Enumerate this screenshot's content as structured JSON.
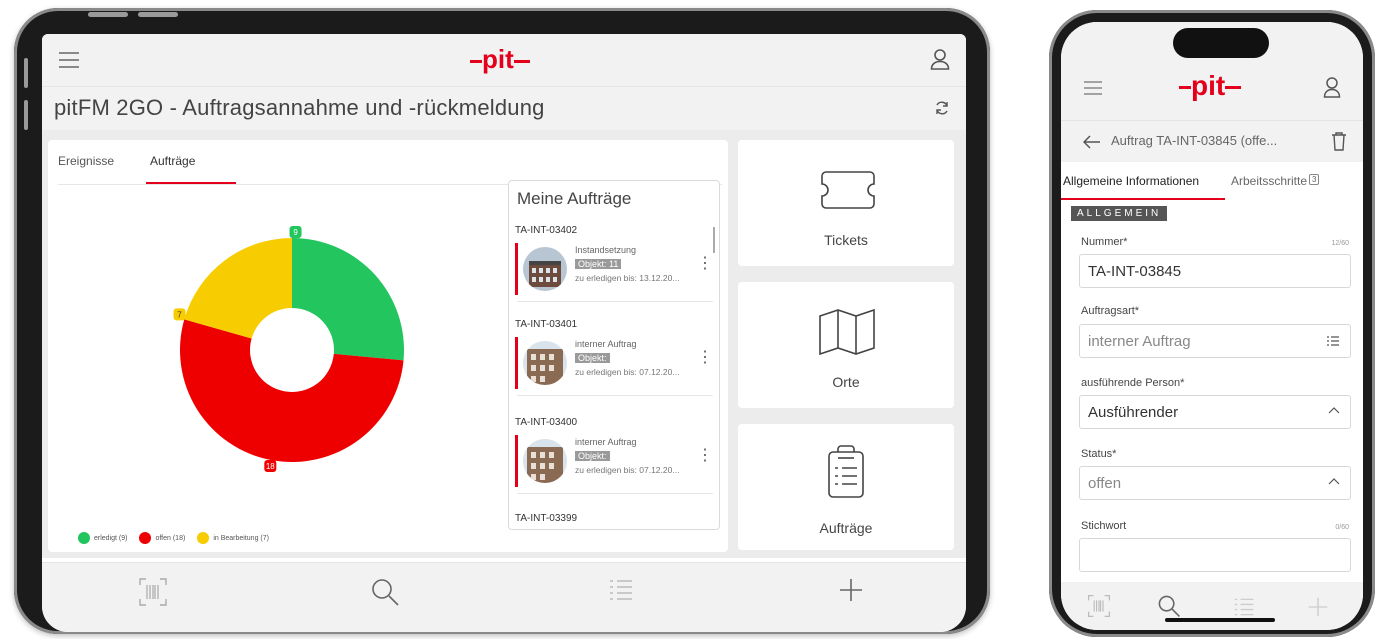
{
  "brand": {
    "logo": "pit",
    "accent": "#e4001b"
  },
  "tablet": {
    "app_title": "pitFM 2GO - Auftragsannahme und -rückmeldung",
    "tabs": [
      {
        "label": "Ereignisse"
      },
      {
        "label": "Aufträge"
      }
    ],
    "chart_data": {
      "type": "pie",
      "categories": [
        "erledigt",
        "offen",
        "in Bearbeitung"
      ],
      "values": [
        9,
        18,
        7
      ],
      "colors": [
        "#22c55e",
        "#ef0000",
        "#f7cc00"
      ],
      "data_labels": [
        "9",
        "18",
        "7"
      ],
      "legend": [
        "erledigt (9)",
        "offen (18)",
        "in Bearbeitung (7)"
      ],
      "legend_position": "bottom-left",
      "donut": true
    },
    "orders_panel": {
      "title": "Meine Aufträge",
      "items": [
        {
          "id": "TA-INT-03402",
          "type": "Instandsetzung",
          "object": "Objekt: 11",
          "due": "zu erledigen bis: 13.12.20..."
        },
        {
          "id": "TA-INT-03401",
          "type": "interner Auftrag",
          "object": "Objekt:",
          "due": "zu erledigen bis: 07.12.20..."
        },
        {
          "id": "TA-INT-03400",
          "type": "interner Auftrag",
          "object": "Objekt:",
          "due": "zu erledigen bis: 07.12.20..."
        },
        {
          "id": "TA-INT-03399"
        }
      ]
    },
    "tiles": [
      {
        "label": "Tickets",
        "icon": "ticket-icon"
      },
      {
        "label": "Orte",
        "icon": "map-icon"
      },
      {
        "label": "Aufträge",
        "icon": "clipboard-icon"
      }
    ],
    "bottom_nav": [
      "barcode-icon",
      "search-icon",
      "list-icon",
      "plus-icon"
    ]
  },
  "phone": {
    "subheader_title": "Auftrag TA-INT-03845 (offe...",
    "tabs": [
      {
        "label": "Allgemeine Informationen"
      },
      {
        "label": "Arbeitsschritte",
        "badge": "3"
      }
    ],
    "section": "ALLGEMEIN",
    "fields": [
      {
        "label": "Nummer*",
        "counter": "12/60",
        "value": "TA-INT-03845"
      },
      {
        "label": "Auftragsart*",
        "value": "interner Auftrag",
        "icon": "list-icon"
      },
      {
        "label": "ausführende Person*",
        "value": "Ausführender",
        "icon": "chevron-up-icon"
      },
      {
        "label": "Status*",
        "value": "offen",
        "icon": "chevron-up-icon"
      },
      {
        "label": "Stichwort",
        "counter": "0/60",
        "value": ""
      }
    ],
    "bottom_nav": [
      "barcode-icon",
      "search-icon",
      "list-icon",
      "plus-icon"
    ]
  }
}
